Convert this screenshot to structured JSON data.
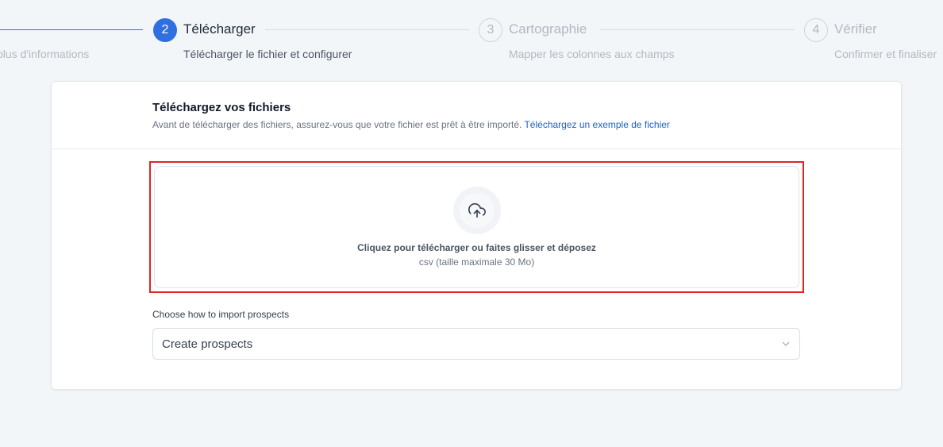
{
  "stepper": {
    "steps": [
      {
        "number": "",
        "title": "",
        "subtitle": "plus d'informations"
      },
      {
        "number": "2",
        "title": "Télécharger",
        "subtitle": "Télécharger le fichier et configurer"
      },
      {
        "number": "3",
        "title": "Cartographie",
        "subtitle": "Mapper les colonnes aux champs"
      },
      {
        "number": "4",
        "title": "Vérifier",
        "subtitle": "Confirmer et finaliser"
      }
    ],
    "active_color": "#2f6fdf"
  },
  "upload_card": {
    "title": "Téléchargez vos fichiers",
    "description": "Avant de télécharger des fichiers, assurez-vous que votre fichier est prêt à être importé.",
    "sample_link": "Téléchargez un exemple de fichier",
    "dropzone": {
      "icon": "cloud-upload-icon",
      "main_text": "Cliquez pour télécharger ou faites glisser et déposez",
      "sub_text": "csv (taille maximale 30 Mo)"
    },
    "highlight_color": "#e02424"
  },
  "import_options": {
    "label": "Choose how to import prospects",
    "selected": "Create prospects"
  }
}
